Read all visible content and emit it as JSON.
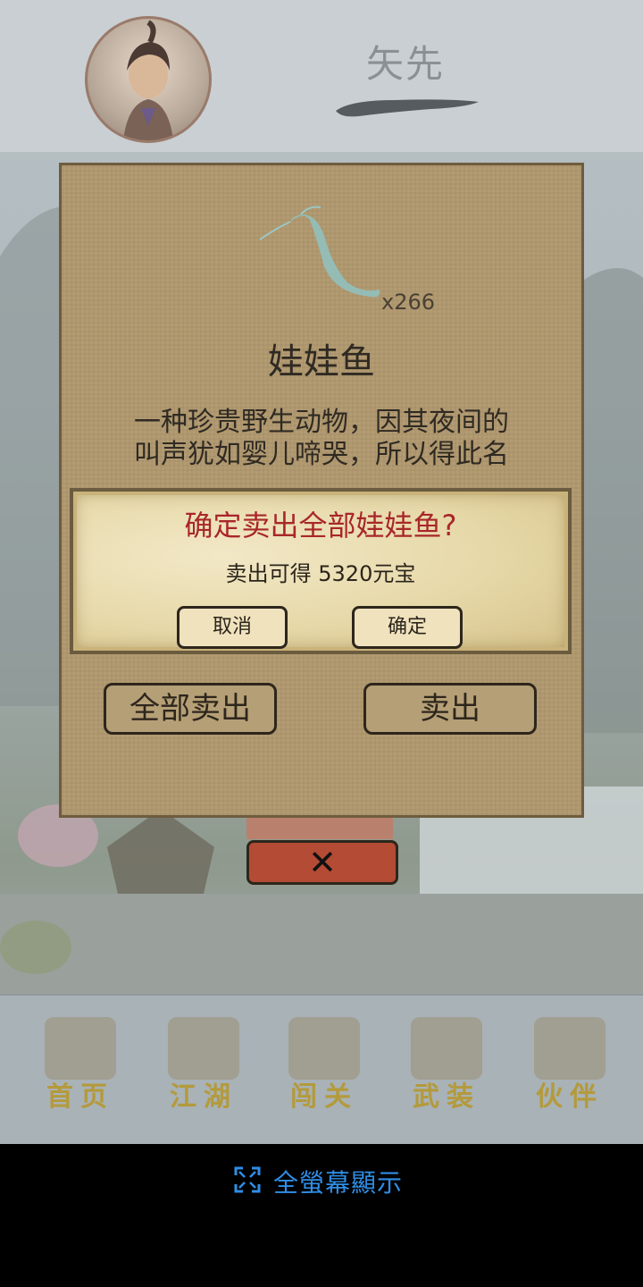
{
  "player": {
    "name": "矢先"
  },
  "item": {
    "quantity": "x266",
    "name": "娃娃鱼",
    "description_lines": [
      "一种珍贵野生动物，因其夜间的",
      "叫声犹如婴儿啼哭，所以得此名"
    ]
  },
  "actions": {
    "sell_all": "全部卖出",
    "sell": "卖出",
    "close_symbol": "✕"
  },
  "confirm_dialog": {
    "title": "确定卖出全部娃娃鱼?",
    "message": "卖出可得 5320元宝",
    "cancel": "取消",
    "ok": "确定"
  },
  "nav": [
    {
      "label": "首页",
      "icon": "home-icon"
    },
    {
      "label": "江湖",
      "icon": "map-scroll-icon"
    },
    {
      "label": "闯关",
      "icon": "crossed-swords-icon"
    },
    {
      "label": "武装",
      "icon": "armor-icon"
    },
    {
      "label": "伙伴",
      "icon": "partners-icon"
    }
  ],
  "fullscreen": {
    "label": "全螢幕顯示",
    "icon": "fullscreen-icon"
  },
  "colors": {
    "confirm_title": "#a8272a",
    "close_button": "#b34b35",
    "fullscreen_text": "#2f8ee6"
  }
}
